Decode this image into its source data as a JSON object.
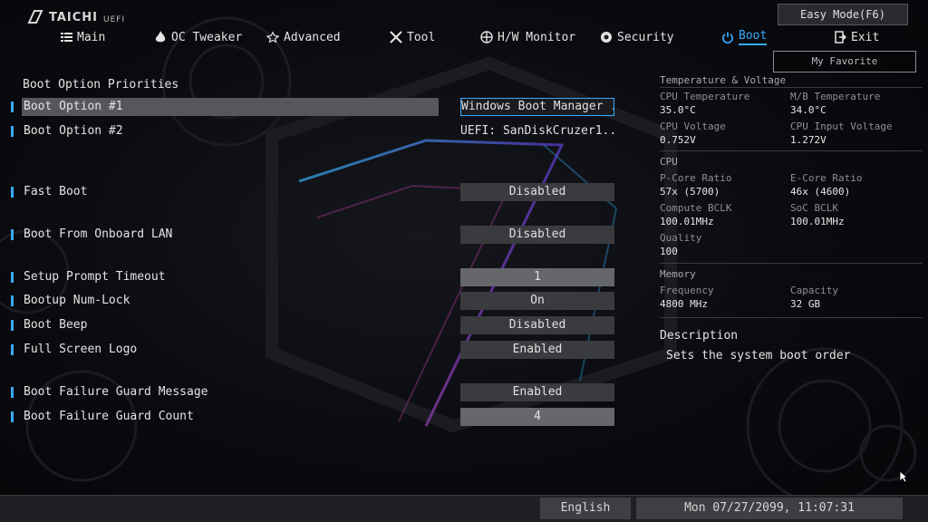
{
  "brand": {
    "logo": "TAICHI",
    "sub": "UEFI"
  },
  "header": {
    "easy_mode": "Easy Mode(F6)",
    "my_favorite": "My Favorite"
  },
  "nav": [
    {
      "label": "Main",
      "icon": "list-icon"
    },
    {
      "label": "OC Tweaker",
      "icon": "flame-icon"
    },
    {
      "label": "Advanced",
      "icon": "star-icon"
    },
    {
      "label": "Tool",
      "icon": "tools-icon"
    },
    {
      "label": "H/W Monitor",
      "icon": "crosshair-icon"
    },
    {
      "label": "Security",
      "icon": "shield-icon"
    },
    {
      "label": "Boot",
      "icon": "power-icon",
      "active": true
    },
    {
      "label": "Exit",
      "icon": "exit-door-icon"
    }
  ],
  "boot": {
    "section_title": "Boot Option Priorities",
    "rows": [
      {
        "label": "Boot Option #1",
        "value": "Windows Boot Manager ..."
      },
      {
        "label": "Boot Option #2",
        "value": "UEFI: SanDiskCruzer1...."
      },
      {
        "label": "Fast Boot",
        "value": "Disabled"
      },
      {
        "label": "Boot From Onboard LAN",
        "value": "Disabled"
      },
      {
        "label": "Setup Prompt Timeout",
        "value": "1"
      },
      {
        "label": "Bootup Num-Lock",
        "value": "On"
      },
      {
        "label": "Boot Beep",
        "value": "Disabled"
      },
      {
        "label": "Full Screen Logo",
        "value": "Enabled"
      },
      {
        "label": "Boot Failure Guard Message",
        "value": "Enabled"
      },
      {
        "label": "Boot Failure Guard Count",
        "value": "4"
      }
    ]
  },
  "monitor": {
    "temp_title": "Temperature & Voltage",
    "cpu_temp_label": "CPU Temperature",
    "cpu_temp": "35.0°C",
    "mb_temp_label": "M/B Temperature",
    "mb_temp": "34.0°C",
    "cpu_volt_label": "CPU Voltage",
    "cpu_volt": "0.752V",
    "cpu_in_volt_label": "CPU Input Voltage",
    "cpu_in_volt": "1.272V",
    "cpu_title": "CPU",
    "pcore_label": "P-Core Ratio",
    "pcore": "57x (5700)",
    "ecore_label": "E-Core Ratio",
    "ecore": "46x (4600)",
    "bclk_label": "Compute BCLK",
    "bclk": "100.01MHz",
    "soc_label": "SoC BCLK",
    "soc": "100.01MHz",
    "quality_label": "Quality",
    "quality": "100",
    "mem_title": "Memory",
    "freq_label": "Frequency",
    "freq": "4800 MHz",
    "cap_label": "Capacity",
    "cap": "32 GB"
  },
  "description": {
    "title": "Description",
    "text": "Sets the system boot order"
  },
  "footer": {
    "language": "English",
    "datetime": "Mon 07/27/2099, 11:07:31"
  },
  "colors": {
    "accent": "#3aa9ff",
    "panel": "#3a3b3f",
    "selected_row": "#55575c"
  }
}
